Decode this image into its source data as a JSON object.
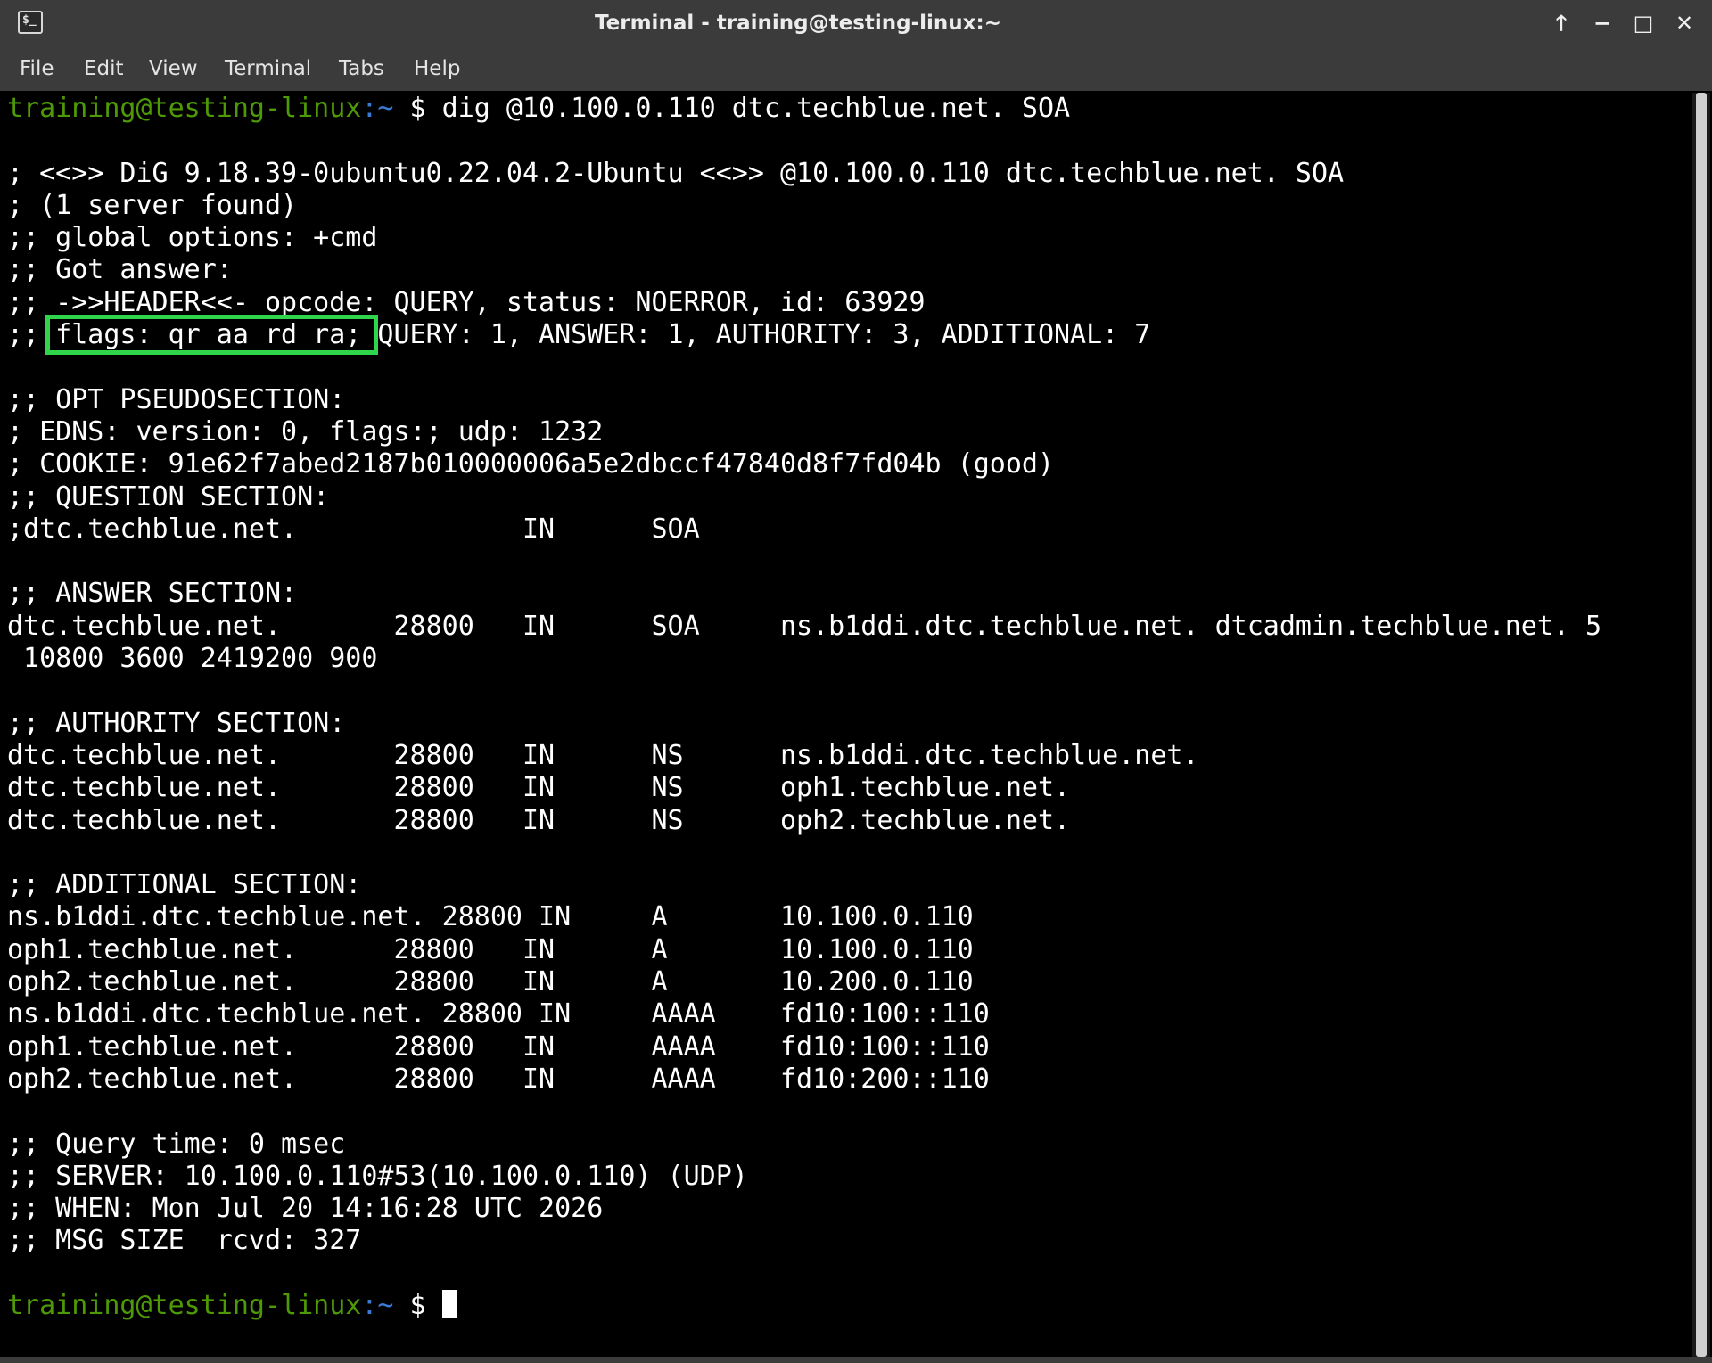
{
  "window": {
    "title": "Terminal - training@testing-linux:~",
    "app_icon_glyph": "$_",
    "controls": {
      "up": "🡑",
      "minimize": "−",
      "maximize": "□",
      "close": "✕"
    }
  },
  "menu": [
    "File",
    "Edit",
    "View",
    "Terminal",
    "Tabs",
    "Help"
  ],
  "prompt": {
    "user_host": "training@testing-linux",
    "path": ":~",
    "symbol": " $ "
  },
  "command": "dig @10.100.0.110 dtc.techblue.net. SOA",
  "output": [
    "",
    "; <<>> DiG 9.18.39-0ubuntu0.22.04.2-Ubuntu <<>> @10.100.0.110 dtc.techblue.net. SOA",
    "; (1 server found)",
    ";; global options: +cmd",
    ";; Got answer:",
    ";; ->>HEADER<<- opcode: QUERY, status: NOERROR, id: 63929",
    ";; flags: qr aa rd ra; QUERY: 1, ANSWER: 1, AUTHORITY: 3, ADDITIONAL: 7",
    "",
    ";; OPT PSEUDOSECTION:",
    "; EDNS: version: 0, flags:; udp: 1232",
    "; COOKIE: 91e62f7abed2187b010000006a5e2dbccf47840d8f7fd04b (good)",
    ";; QUESTION SECTION:",
    ";dtc.techblue.net.\t\tIN\tSOA",
    "",
    ";; ANSWER SECTION:",
    "dtc.techblue.net.\t28800\tIN\tSOA\tns.b1ddi.dtc.techblue.net. dtcadmin.techblue.net. 5",
    " 10800 3600 2419200 900",
    "",
    ";; AUTHORITY SECTION:",
    "dtc.techblue.net.\t28800\tIN\tNS\tns.b1ddi.dtc.techblue.net.",
    "dtc.techblue.net.\t28800\tIN\tNS\toph1.techblue.net.",
    "dtc.techblue.net.\t28800\tIN\tNS\toph2.techblue.net.",
    "",
    ";; ADDITIONAL SECTION:",
    "ns.b1ddi.dtc.techblue.net. 28800 IN\tA\t10.100.0.110",
    "oph1.techblue.net.\t28800\tIN\tA\t10.100.0.110",
    "oph2.techblue.net.\t28800\tIN\tA\t10.200.0.110",
    "ns.b1ddi.dtc.techblue.net. 28800 IN\tAAAA\tfd10:100::110",
    "oph1.techblue.net.\t28800\tIN\tAAAA\tfd10:100::110",
    "oph2.techblue.net.\t28800\tIN\tAAAA\tfd10:200::110",
    "",
    ";; Query time: 0 msec",
    ";; SERVER: 10.100.0.110#53(10.100.0.110) (UDP)",
    ";; WHEN: Mon Jul 20 14:16:28 UTC 2026",
    ";; MSG SIZE  rcvd: 327",
    ""
  ],
  "colors": {
    "prompt_user": "#4e9a06",
    "prompt_path": "#3a7bd5",
    "highlight": "#2fd64b",
    "background": "#000000"
  }
}
